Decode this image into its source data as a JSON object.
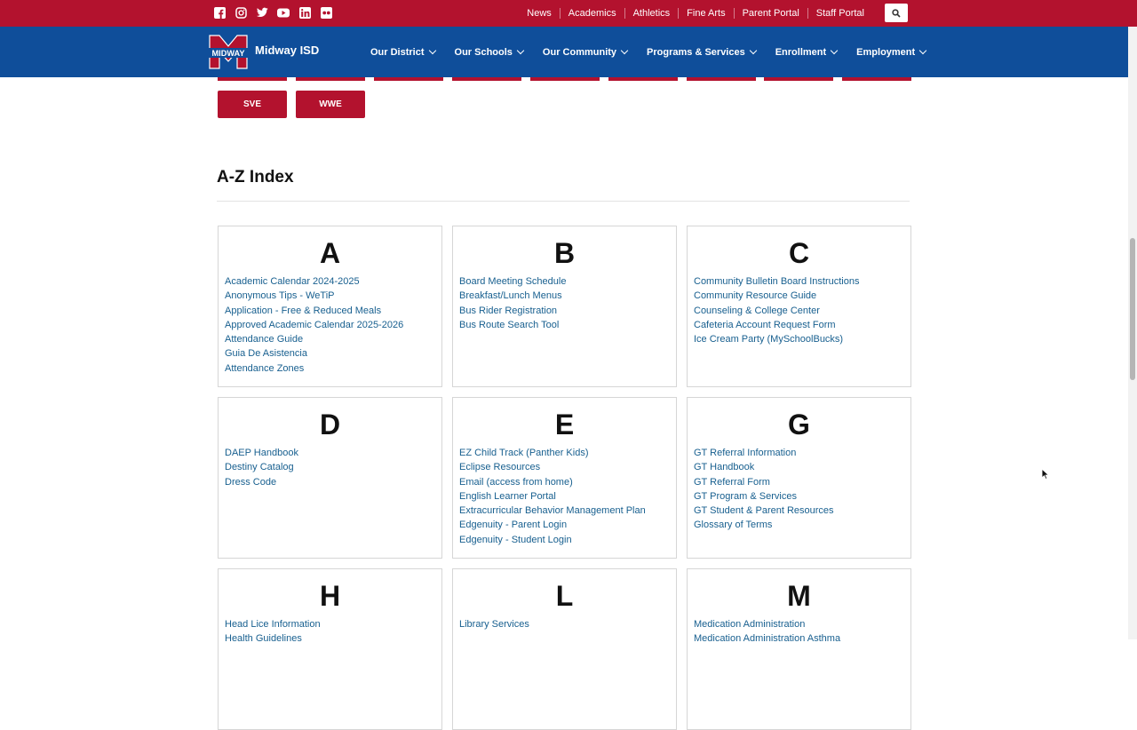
{
  "top_links": [
    "News",
    "Academics",
    "Athletics",
    "Fine Arts",
    "Parent Portal",
    "Staff Portal"
  ],
  "social_icons": [
    "facebook-icon",
    "instagram-icon",
    "twitter-icon",
    "youtube-icon",
    "linkedin-icon",
    "flickr-icon"
  ],
  "brand": {
    "logo_text": "MIDWAY",
    "name": "Midway ISD"
  },
  "nav": [
    "Our District",
    "Our Schools",
    "Our Community",
    "Programs & Services",
    "Enrollment",
    "Employment"
  ],
  "school_buttons": [
    "SVE",
    "WWE"
  ],
  "az_title": "A-Z Index",
  "colors": {
    "red": "#b3122e",
    "blue": "#0f4e9a",
    "link": "#175f8f"
  },
  "cards": [
    {
      "letter": "A",
      "links": [
        "Academic Calendar 2024-2025",
        "Anonymous Tips - WeTiP",
        "Application - Free & Reduced Meals",
        "Approved Academic Calendar 2025-2026",
        "Attendance Guide",
        "Guia De Asistencia",
        "Attendance Zones"
      ]
    },
    {
      "letter": "B",
      "links": [
        "Board Meeting Schedule",
        "Breakfast/Lunch Menus",
        "Bus Rider Registration",
        "Bus Route Search Tool"
      ]
    },
    {
      "letter": "C",
      "links": [
        "Community Bulletin Board Instructions",
        "Community Resource Guide",
        "Counseling & College Center",
        "Cafeteria Account Request Form",
        "Ice Cream Party (MySchoolBucks)"
      ]
    },
    {
      "letter": "D",
      "links": [
        "DAEP Handbook",
        "Destiny Catalog",
        "Dress Code"
      ]
    },
    {
      "letter": "E",
      "links": [
        "EZ Child Track (Panther Kids)",
        "Eclipse Resources",
        "Email (access from home)",
        "English Learner Portal",
        "Extracurricular Behavior Management Plan",
        "Edgenuity - Parent Login",
        "Edgenuity - Student Login"
      ]
    },
    {
      "letter": "G",
      "links": [
        "GT Referral Information",
        "GT Handbook",
        "GT Referral Form",
        "GT Program & Services",
        "GT Student & Parent Resources",
        "Glossary of Terms"
      ]
    },
    {
      "letter": "H",
      "links": [
        "Head Lice Information",
        "Health Guidelines"
      ]
    },
    {
      "letter": "L",
      "links": [
        "Library Services"
      ]
    },
    {
      "letter": "M",
      "links": [
        "Medication Administration",
        "Medication Administration Asthma"
      ]
    }
  ]
}
